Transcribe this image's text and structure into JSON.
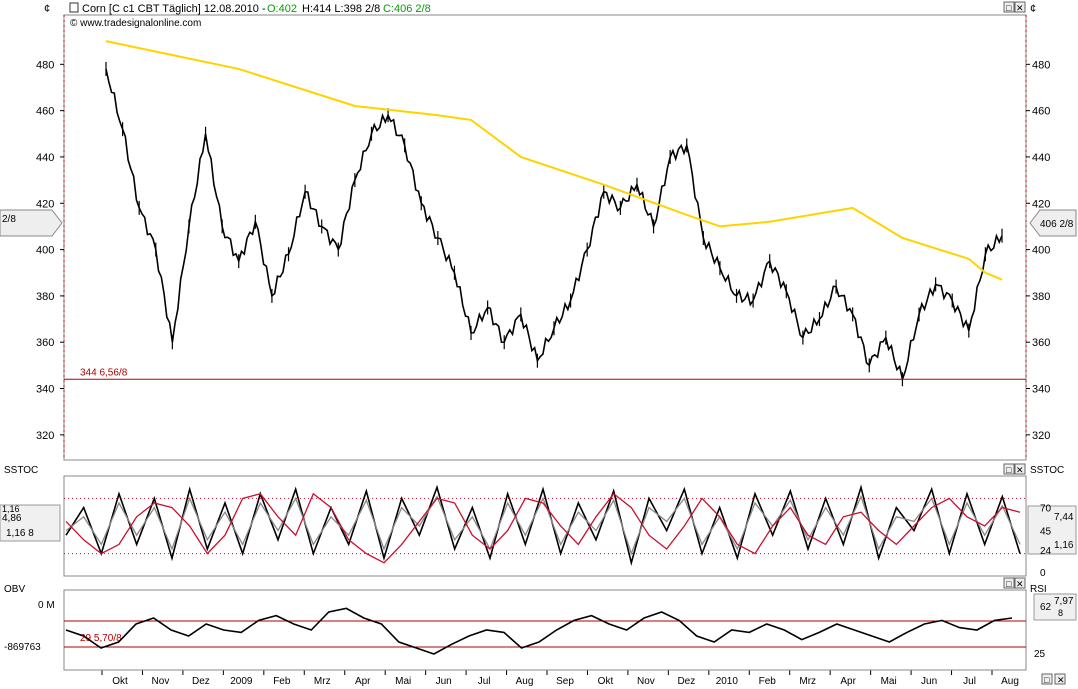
{
  "header": {
    "currency_symbol": "¢",
    "instrument": "Corn [C c1 CBT  Täglich] 12.08.2010 -",
    "open": "O:402",
    "hl": "H:414 L:398 2/8",
    "close": "C:406 2/8",
    "copyright": "© www.tradesignalonline.com"
  },
  "colors": {
    "price": "#000000",
    "moving_average": "#ffd200",
    "support_line": "#b00000",
    "stoch_k": "#000000",
    "stoch_d": "#888888",
    "stoch_signal": "#c8102e",
    "axis_line": "#c00000"
  },
  "chart_data": [
    {
      "type": "ohlc",
      "panel": "price",
      "x": [
        "2009-10-01",
        "2009-10-15",
        "2009-11-01",
        "2009-11-10",
        "2009-11-20",
        "2009-12-01",
        "2009-12-15",
        "2009-12-28",
        "2010-01-10",
        "2010-01-25",
        "2010-02-08",
        "2010-02-22",
        "2010-03-05",
        "2010-03-20",
        "2010-04-05",
        "2010-04-20",
        "2010-05-01",
        "2010-05-12",
        "2010-05-22",
        "2010-06-01",
        "2010-06-05",
        "2010-06-12",
        "2010-06-22",
        "2010-07-01",
        "2010-07-15",
        "2010-08-01",
        "2010-08-15",
        "2010-08-25",
        "2010-09-05",
        "2010-09-18",
        "2010-10-01",
        "2010-10-10",
        "2010-10-25",
        "2010-11-10",
        "2010-11-25",
        "2010-12-08",
        "2010-12-22",
        "2011-01-05",
        "2011-01-20",
        "2011-02-05",
        "2011-02-20",
        "2011-03-05",
        "2011-03-20",
        "2011-04-05",
        "2011-04-20",
        "2011-05-05",
        "2011-05-15",
        "2011-05-28",
        "2011-06-08",
        "2011-06-20",
        "2011-07-01",
        "2011-07-15",
        "2011-07-28",
        "2011-08-05",
        "2011-08-12"
      ],
      "close": [
        478,
        452,
        418,
        400,
        360,
        410,
        450,
        410,
        395,
        412,
        380,
        398,
        425,
        410,
        400,
        430,
        450,
        458,
        445,
        420,
        405,
        390,
        364,
        375,
        360,
        372,
        352,
        366,
        378,
        400,
        425,
        418,
        428,
        410,
        440,
        445,
        405,
        392,
        380,
        378,
        395,
        382,
        362,
        370,
        384,
        372,
        350,
        362,
        344,
        372,
        385,
        378,
        365,
        398,
        406
      ],
      "moving_average_name": "",
      "moving_average": [
        [
          0,
          490
        ],
        [
          8,
          478
        ],
        [
          15,
          462
        ],
        [
          20,
          458
        ],
        [
          22,
          456
        ],
        [
          25,
          440
        ],
        [
          30,
          428
        ],
        [
          35,
          415
        ],
        [
          37,
          410
        ],
        [
          40,
          412
        ],
        [
          45,
          418
        ],
        [
          48,
          405
        ],
        [
          52,
          396
        ],
        [
          53,
          390
        ],
        [
          54,
          387
        ]
      ],
      "support_level": 344,
      "support_label": "344 6,56/8",
      "last_price_label": "406 2/8",
      "last_price_label_left": "2/8",
      "ylim": [
        310,
        500
      ],
      "yticks": [
        320,
        340,
        360,
        380,
        400,
        420,
        440,
        460,
        480
      ],
      "xticks": [
        "Okt",
        "Nov",
        "Dez",
        "2009",
        "Feb",
        "Mrz",
        "Apr",
        "Mai",
        "Jun",
        "Jul",
        "Aug",
        "Sep",
        "Okt",
        "Nov",
        "Dez",
        "2010",
        "Feb",
        "Mrz",
        "Apr",
        "Mai",
        "Jun",
        "Jul",
        "Aug"
      ]
    },
    {
      "type": "line",
      "panel": "stochastic",
      "title": "SSTOC",
      "ylim": [
        0,
        100
      ],
      "yticks": [
        0,
        24,
        45,
        70
      ],
      "levels": [
        20,
        80
      ],
      "series": [
        {
          "values": [
            40,
            70,
            20,
            85,
            30,
            80,
            15,
            90,
            25,
            75,
            20,
            85,
            35,
            90,
            20,
            70,
            30,
            88,
            15,
            80,
            40,
            92,
            25,
            70,
            15,
            85,
            30,
            90,
            20,
            75,
            35,
            88,
            10,
            80,
            45,
            90,
            20,
            70,
            15,
            85,
            40,
            88,
            25,
            80,
            30,
            92,
            15,
            70,
            45,
            90,
            20,
            85,
            30,
            82,
            20
          ]
        },
        {
          "values": [
            45,
            60,
            30,
            75,
            40,
            70,
            25,
            80,
            35,
            65,
            30,
            75,
            45,
            80,
            30,
            60,
            40,
            78,
            25,
            70,
            50,
            82,
            35,
            60,
            25,
            75,
            40,
            80,
            30,
            65,
            45,
            78,
            20,
            70,
            55,
            80,
            30,
            60,
            25,
            75,
            50,
            78,
            35,
            70,
            40,
            82,
            25,
            60,
            55,
            80,
            30,
            75,
            40,
            72,
            30
          ]
        },
        {
          "values": [
            55,
            35,
            20,
            30,
            60,
            75,
            70,
            50,
            20,
            40,
            80,
            85,
            60,
            40,
            85,
            70,
            35,
            20,
            10,
            30,
            55,
            80,
            75,
            40,
            25,
            45,
            80,
            75,
            50,
            30,
            60,
            85,
            70,
            40,
            25,
            50,
            80,
            60,
            30,
            20,
            50,
            70,
            40,
            30,
            60,
            65,
            45,
            30,
            50,
            70,
            80,
            60,
            50,
            70,
            65
          ]
        }
      ],
      "right_labels": [
        "70",
        "45",
        "24",
        "0"
      ],
      "value_labels": [
        "7,44",
        "4,86",
        "1,16"
      ],
      "value_labels_right": [
        "7,44 8",
        "1,16 8"
      ]
    },
    {
      "type": "line",
      "panel": "obv_rsi",
      "title_left": "OBV",
      "title_right": "RSI",
      "obv_labels": [
        "0 M",
        "-869763"
      ],
      "rsi_level_label": "29 5,70/8",
      "rsi_yticks": [
        "62",
        "25"
      ],
      "rsi_value_label": "7,97",
      "rsi_value_label_sub": "8",
      "series": [
        {
          "values": [
            30,
            25,
            15,
            20,
            35,
            40,
            30,
            25,
            35,
            30,
            28,
            38,
            42,
            35,
            30,
            45,
            48,
            40,
            35,
            20,
            15,
            10,
            18,
            25,
            30,
            28,
            15,
            20,
            30,
            38,
            42,
            35,
            30,
            40,
            45,
            38,
            25,
            20,
            30,
            28,
            35,
            30,
            22,
            28,
            35,
            30,
            25,
            20,
            28,
            35,
            38,
            32,
            30,
            38,
            40
          ]
        }
      ]
    }
  ],
  "toolbar": {
    "price_panel_controls": [
      "□",
      "✕"
    ],
    "stoch_panel_controls": [
      "□",
      "✕"
    ],
    "obv_panel_controls": [
      "□",
      "✕"
    ],
    "bottom_controls": [
      "□",
      "✕"
    ]
  }
}
